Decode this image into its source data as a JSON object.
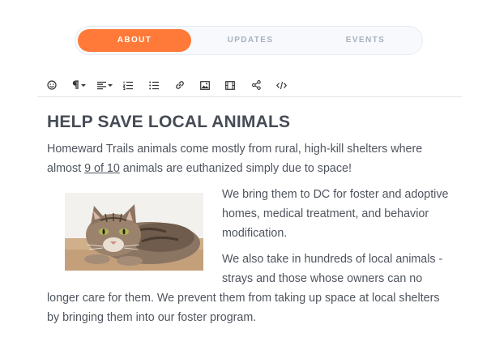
{
  "tabs": [
    {
      "label": "ABOUT",
      "active": true
    },
    {
      "label": "UPDATES",
      "active": false
    },
    {
      "label": "EVENTS",
      "active": false
    }
  ],
  "toolbar": {
    "buttons": [
      {
        "icon": "emoji-icon"
      },
      {
        "icon": "paragraph-format-icon",
        "dropdown": true
      },
      {
        "icon": "align-icon",
        "dropdown": true
      },
      {
        "icon": "ordered-list-icon"
      },
      {
        "icon": "unordered-list-icon"
      },
      {
        "icon": "link-icon"
      },
      {
        "icon": "image-icon"
      },
      {
        "icon": "video-icon"
      },
      {
        "icon": "share-icon"
      },
      {
        "icon": "code-icon"
      }
    ]
  },
  "article": {
    "heading": "HELP SAVE LOCAL ANIMALS",
    "intro_before": "Homeward Trails animals come mostly from rural, high-kill shelters where almost ",
    "intro_link": "9 of 10",
    "intro_after": " animals are euthanized simply due to space!",
    "para1": "We bring them to DC for foster and adoptive homes, medical treatment, and behavior modification.",
    "para2": "We also take in hundreds of local animals - strays and those whose owners can no longer care for them. We prevent them from taking up space at local shelters by bringing them into our foster program."
  },
  "image": {
    "subject": "tabby cat lying on wooden floor"
  }
}
